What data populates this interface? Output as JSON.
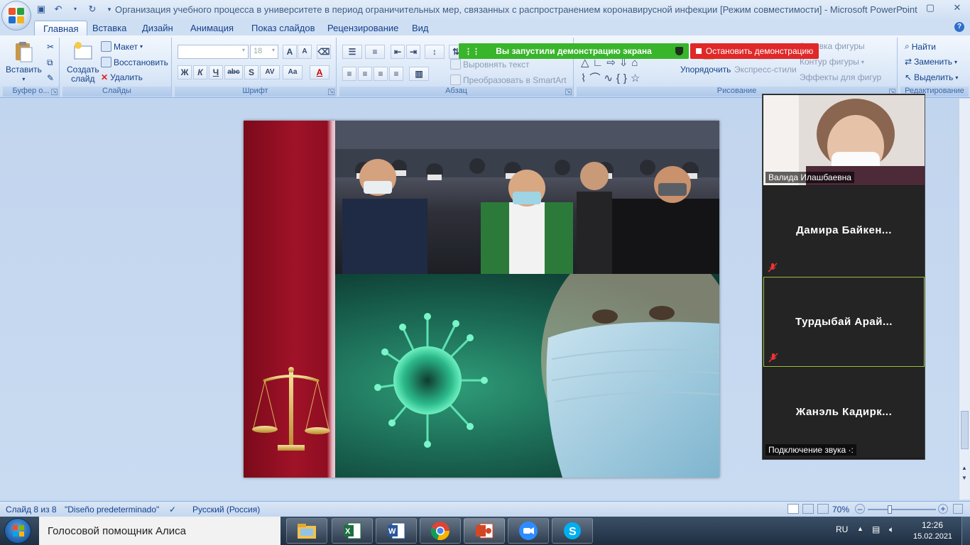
{
  "window": {
    "title": "Организация учебного процесса в университете в период ограничительных мер, связанных с распространением коронавирусной инфекции [Режим совместимости] - Microsoft PowerPoint"
  },
  "tabs": [
    {
      "label": "Главная"
    },
    {
      "label": "Вставка"
    },
    {
      "label": "Дизайн"
    },
    {
      "label": "Анимация"
    },
    {
      "label": "Показ слайдов"
    },
    {
      "label": "Рецензирование"
    },
    {
      "label": "Вид"
    }
  ],
  "ribbon": {
    "clipboard": {
      "paste": "Вставить",
      "label": "Буфер о..."
    },
    "slides": {
      "new_slide_1": "Создать",
      "new_slide_2": "слайд",
      "layout": "Макет",
      "reset": "Восстановить",
      "delete": "Удалить",
      "label": "Слайды"
    },
    "font": {
      "font_size": "18",
      "label": "Шрифт",
      "bold": "Ж",
      "italic": "К",
      "underline": "Ч",
      "strike": "abc",
      "shadow": "S",
      "spacing": "AV",
      "case": "Aa",
      "color": "A",
      "grow": "A",
      "shrink": "A"
    },
    "paragraph": {
      "align_text": "Выровнять текст",
      "smartart": "Преобразовать в SmartArt",
      "label": "Абзац"
    },
    "drawing": {
      "arrange": "Упорядочить",
      "quick_styles": "Экспресс-стили",
      "fill": "Заливка фигуры",
      "outline": "Контур фигуры",
      "effects": "Эффекты для фигур",
      "label": "Рисование"
    },
    "editing": {
      "find": "Найти",
      "replace": "Заменить",
      "select": "Выделить",
      "label": "Редактирование"
    }
  },
  "zoom": {
    "share_banner": "Вы запустили демонстрацию экрана",
    "stop_share": "Остановить демонстрацию",
    "participants": [
      {
        "name": "Валида Илашбаевна",
        "has_video": true
      },
      {
        "name": "Дамира  Байкен...",
        "muted": true
      },
      {
        "name": "Турдыбай  Арай...",
        "muted": true,
        "active": true
      },
      {
        "name": "Жанэль  Кадирк...",
        "muted": false
      }
    ],
    "audio_label": "Подключение звука ·:"
  },
  "status_bar": {
    "slide": "Слайд 8 из 8",
    "theme": "\"Diseño predeterminado\"",
    "language": "Русский (Россия)",
    "zoom": "70%"
  },
  "taskbar": {
    "search_text": "Голосовой помощник Алиса",
    "language": "RU",
    "time": "12:26",
    "date": "15.02.2021",
    "apps": [
      "file-explorer",
      "excel",
      "word",
      "chrome",
      "powerpoint",
      "zoom",
      "skype"
    ]
  },
  "colors": {
    "ribbon_blue": "#dde9f8",
    "share_green": "#38b52b",
    "stop_red": "#e02828",
    "slide_crimson": "#a01228"
  }
}
